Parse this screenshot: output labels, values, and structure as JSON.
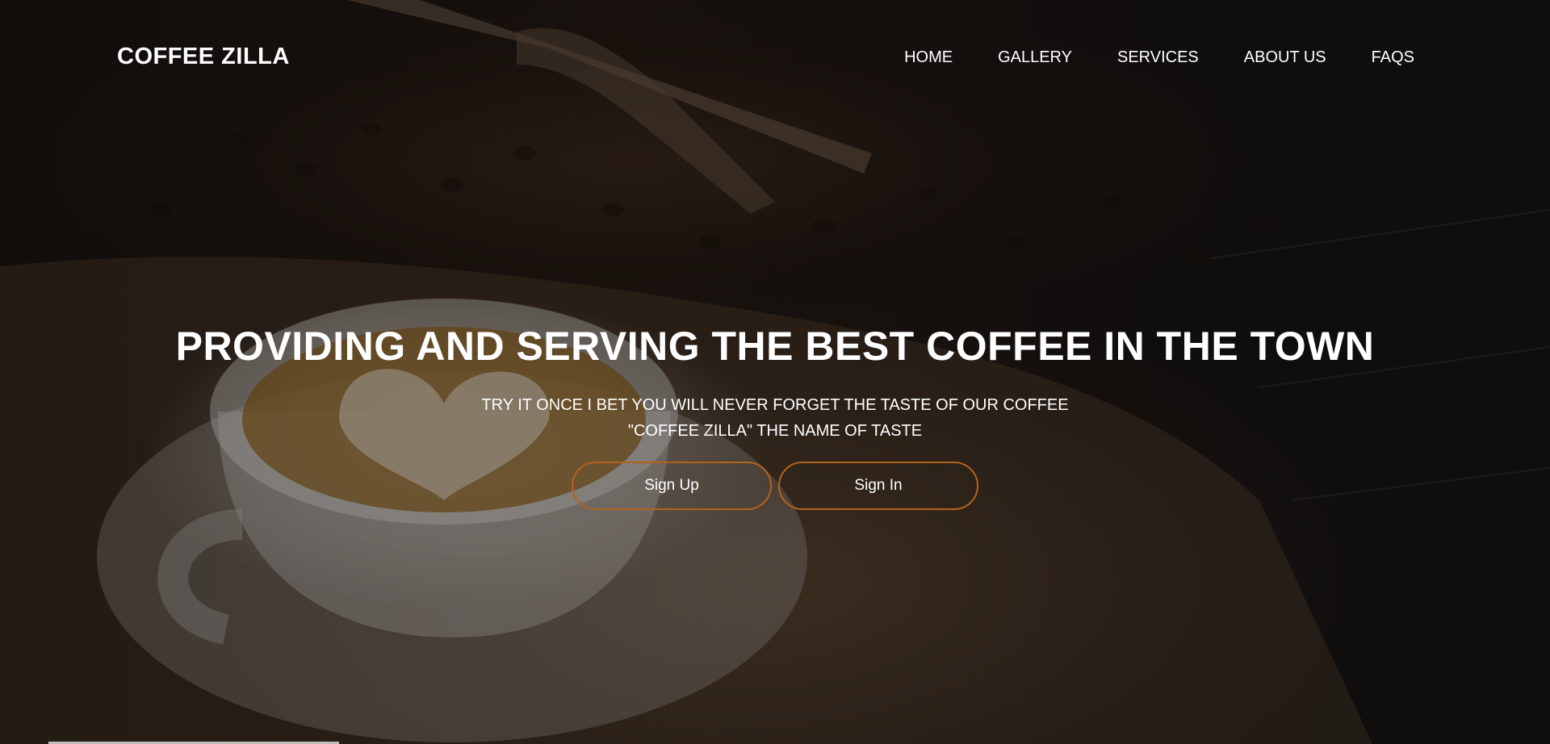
{
  "brand": "COFFEE ZILLA",
  "nav": {
    "items": [
      "HOME",
      "GALLERY",
      "SERVICES",
      "ABOUT US",
      "FAQS"
    ]
  },
  "hero": {
    "headline": "PROVIDING AND SERVING THE BEST COFFEE IN THE TOWN",
    "tagline_1": "TRY IT ONCE I BET YOU WILL NEVER FORGET THE TASTE OF OUR COFFEE",
    "tagline_2": "\"COFFEE ZILLA\" THE NAME OF TASTE"
  },
  "buttons": {
    "signup": "Sign Up",
    "signin": "Sign In"
  },
  "colors": {
    "button_border": "#b3621c",
    "text": "#ffffff"
  }
}
